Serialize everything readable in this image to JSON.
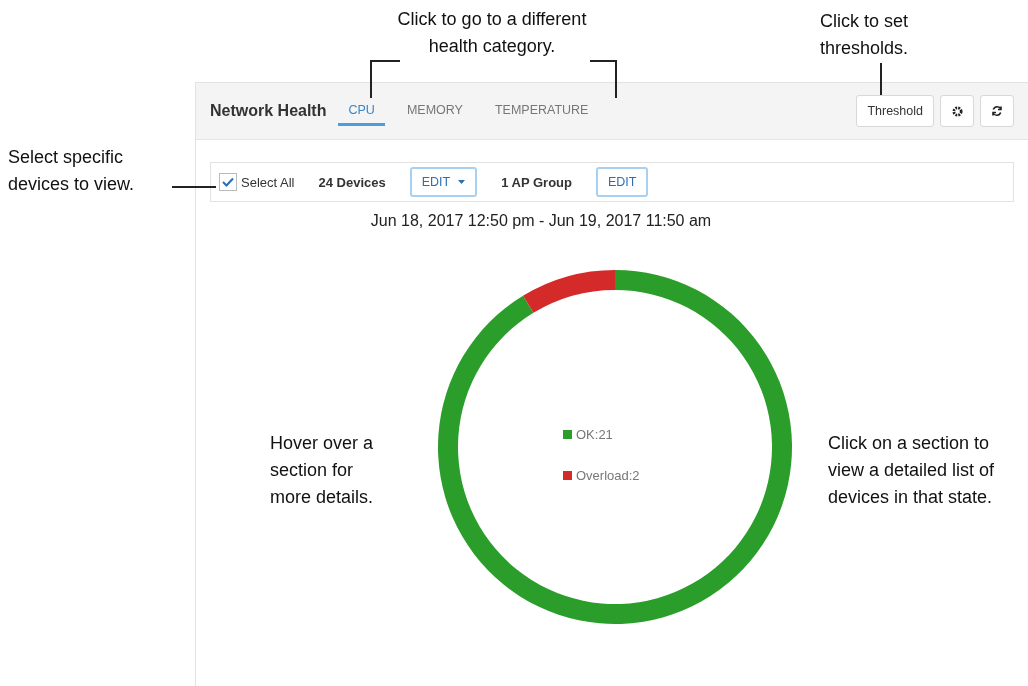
{
  "callouts": [
    {
      "text": "Click to go to a different health category."
    },
    {
      "text": "Click to set thresholds."
    },
    {
      "text": "Select specific devices to view."
    },
    {
      "text": "Hover over a section for more details."
    },
    {
      "text": "Click on a section to view a detailed list of devices in that state."
    }
  ],
  "panel": {
    "title": "Network Health",
    "tabs": [
      {
        "label": "CPU",
        "selected": true
      },
      {
        "label": "MEMORY",
        "selected": false
      },
      {
        "label": "TEMPERATURE",
        "selected": false
      }
    ],
    "threshold_button": "Threshold",
    "filter": {
      "select_all": {
        "label": "Select All",
        "checked": true
      },
      "devices": "24 Devices",
      "devices_edit": "EDIT",
      "group": "1 AP Group",
      "group_edit": "EDIT"
    },
    "date_range": "Jun 18, 2017 12:50 pm - Jun 19, 2017 11:50 am",
    "slices": [
      {
        "color": "#2a9d2a"
      },
      {
        "color": "#d42a2a"
      }
    ],
    "chart_data": {
      "type": "donut",
      "categories": [
        "OK:21",
        "Overload:2"
      ],
      "values": [
        21,
        2
      ],
      "legend": "center"
    }
  }
}
